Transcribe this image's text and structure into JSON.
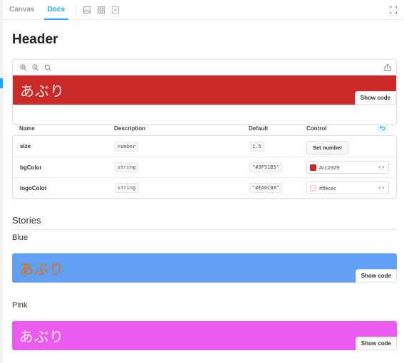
{
  "toolbar": {
    "tabs": [
      {
        "label": "Canvas"
      },
      {
        "label": "Docs"
      }
    ]
  },
  "docs": {
    "title": "Header",
    "preview": {
      "logo_text": "あぶり",
      "bg_color": "#cc2929",
      "logo_color": "#ffecec",
      "show_code_label": "Show code"
    },
    "args_table": {
      "headers": {
        "name": "Name",
        "description": "Description",
        "default": "Default",
        "control": "Control"
      },
      "rows": [
        {
          "name": "size",
          "type": "number",
          "default": "1.5",
          "control_label": "Set number"
        },
        {
          "name": "bgColor",
          "type": "string",
          "default": "\"#3F51B5\"",
          "control_value": "#cc2929",
          "swatch": "#cc2929"
        },
        {
          "name": "logoColor",
          "type": "string",
          "default": "\"#EA6C00\"",
          "control_value": "#ffecec",
          "swatch": "#ffecec"
        }
      ]
    },
    "stories": {
      "title": "Stories",
      "items": [
        {
          "name": "Blue",
          "logo_text": "あぶり",
          "bg_color": "#61a0f5",
          "logo_color": "#ea6c00",
          "show_code_label": "Show code"
        },
        {
          "name": "Pink",
          "logo_text": "あぶり",
          "bg_color": "#ec5bef",
          "logo_color": "#ffecec",
          "show_code_label": "Show code"
        }
      ]
    }
  }
}
